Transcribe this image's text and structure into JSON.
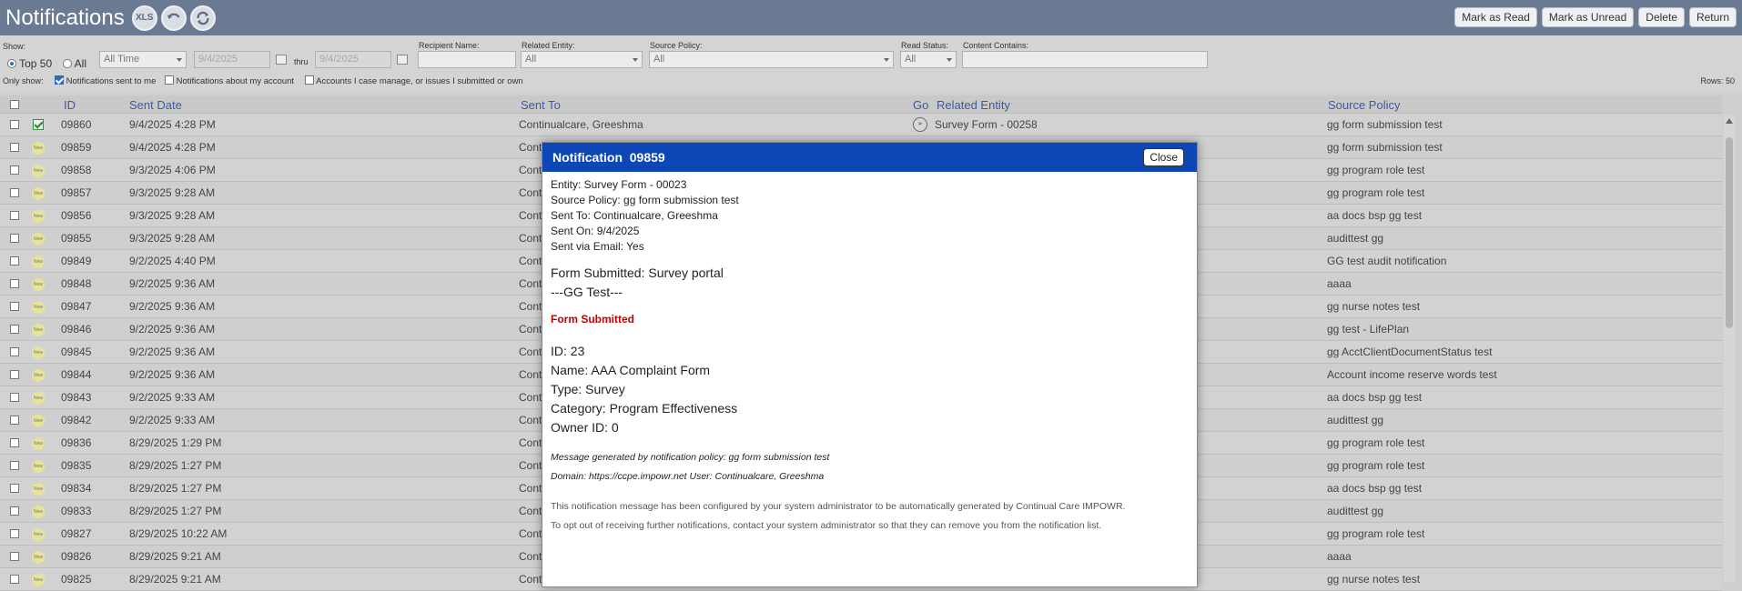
{
  "header": {
    "title": "Notifications",
    "xls_label": "XLS",
    "buttons": {
      "mark_read": "Mark as Read",
      "mark_unread": "Mark as Unread",
      "delete": "Delete",
      "return": "Return"
    }
  },
  "filters": {
    "show_label": "Show:",
    "top50_label": "Top 50",
    "all_label": "All",
    "time_value": "All Time",
    "date_from_placeholder": "9/4/2025",
    "thru_label": "thru",
    "date_to_placeholder": "9/4/2025",
    "recipient_label": "Recipient Name:",
    "recipient_value": "",
    "related_entity_label": "Related Entity:",
    "related_entity_value": "All",
    "source_policy_label": "Source Policy:",
    "source_policy_value": "All",
    "read_status_label": "Read Status:",
    "read_status_value": "All",
    "content_contains_label": "Content Contains:",
    "content_contains_value": "",
    "only_show_label": "Only show:",
    "opt_sent_to_me": "Notifications sent to me",
    "opt_about_account": "Notifications about my account",
    "opt_case_manage": "Accounts I case manage, or issues I submitted or own",
    "rows_label": "Rows: 50"
  },
  "table": {
    "columns": {
      "id": "ID",
      "sent_date": "Sent Date",
      "sent_to": "Sent To",
      "go": "Go",
      "related_entity": "Related Entity",
      "source_policy": "Source Policy"
    },
    "new_badge": "New",
    "rows": [
      {
        "id": "09860",
        "date": "9/4/2025 4:28 PM",
        "to": "Continualcare, Greeshma",
        "entity": "Survey Form - 00258",
        "policy": "gg form submission test"
      },
      {
        "id": "09859",
        "date": "9/4/2025 4:28 PM",
        "to": "Cont",
        "entity": "",
        "policy": "gg form submission test"
      },
      {
        "id": "09858",
        "date": "9/3/2025 4:06 PM",
        "to": "Cont",
        "entity": "",
        "policy": "gg program role test"
      },
      {
        "id": "09857",
        "date": "9/3/2025 9:28 AM",
        "to": "Cont",
        "entity": "",
        "policy": "gg program role test"
      },
      {
        "id": "09856",
        "date": "9/3/2025 9:28 AM",
        "to": "Cont",
        "entity": "",
        "policy": "aa docs bsp gg test"
      },
      {
        "id": "09855",
        "date": "9/3/2025 9:28 AM",
        "to": "Cont",
        "entity": "",
        "policy": "audittest gg"
      },
      {
        "id": "09849",
        "date": "9/2/2025 4:40 PM",
        "to": "Cont",
        "entity": "",
        "policy": "GG test audit notification"
      },
      {
        "id": "09848",
        "date": "9/2/2025 9:36 AM",
        "to": "Cont",
        "entity": "",
        "policy": "aaaa"
      },
      {
        "id": "09847",
        "date": "9/2/2025 9:36 AM",
        "to": "Cont",
        "entity": "",
        "policy": "gg nurse notes test"
      },
      {
        "id": "09846",
        "date": "9/2/2025 9:36 AM",
        "to": "Cont",
        "entity": "",
        "policy": "gg test - LifePlan"
      },
      {
        "id": "09845",
        "date": "9/2/2025 9:36 AM",
        "to": "Cont",
        "entity": "",
        "policy": "gg AcctClientDocumentStatus test"
      },
      {
        "id": "09844",
        "date": "9/2/2025 9:36 AM",
        "to": "Cont",
        "entity": "",
        "policy": "Account income reserve words test"
      },
      {
        "id": "09843",
        "date": "9/2/2025 9:33 AM",
        "to": "Cont",
        "entity": "",
        "policy": "aa docs bsp gg test"
      },
      {
        "id": "09842",
        "date": "9/2/2025 9:33 AM",
        "to": "Cont",
        "entity": "",
        "policy": "audittest gg"
      },
      {
        "id": "09836",
        "date": "8/29/2025 1:29 PM",
        "to": "Cont",
        "entity": "",
        "policy": "gg program role test"
      },
      {
        "id": "09835",
        "date": "8/29/2025 1:27 PM",
        "to": "Cont",
        "entity": "",
        "policy": "gg program role test"
      },
      {
        "id": "09834",
        "date": "8/29/2025 1:27 PM",
        "to": "Cont",
        "entity": "",
        "policy": "aa docs bsp gg test"
      },
      {
        "id": "09833",
        "date": "8/29/2025 1:27 PM",
        "to": "Cont",
        "entity": "",
        "policy": "audittest gg"
      },
      {
        "id": "09827",
        "date": "8/29/2025 10:22 AM",
        "to": "Cont",
        "entity": "",
        "policy": "gg program role test"
      },
      {
        "id": "09826",
        "date": "8/29/2025 9:21 AM",
        "to": "Cont",
        "entity": "",
        "policy": "aaaa"
      },
      {
        "id": "09825",
        "date": "8/29/2025 9:21 AM",
        "to": "Cont",
        "entity": "",
        "policy": "gg nurse notes test"
      }
    ]
  },
  "modal": {
    "title": "Notification  09859",
    "close_label": "Close",
    "entity": "Entity: Survey Form - 00023",
    "source_policy": "Source Policy: gg form submission test",
    "sent_to": "Sent To: Continualcare, Greeshma",
    "sent_on": "Sent On: 9/4/2025",
    "sent_via_email": "Sent via Email: Yes",
    "form_line1": "Form Submitted: Survey portal",
    "form_line2": "---GG Test---",
    "form_submitted_heading": "Form Submitted",
    "detail_id": "ID: 23",
    "detail_name": "Name: AAA Complaint Form",
    "detail_type": "Type: Survey",
    "detail_category": "Category: Program Effectiveness",
    "detail_owner": "Owner ID: 0",
    "generated_by": "Message generated by notification policy: gg form submission test",
    "domain_user": "Domain: https://ccpe.impowr.net User: Continualcare, Greeshma",
    "note1": "This notification message has been configured by your system administrator to be automatically generated by Continual Care IMPOWR.",
    "note2": "To opt out of receiving further notifications, contact your system administrator so that they can remove you from the notification list."
  }
}
